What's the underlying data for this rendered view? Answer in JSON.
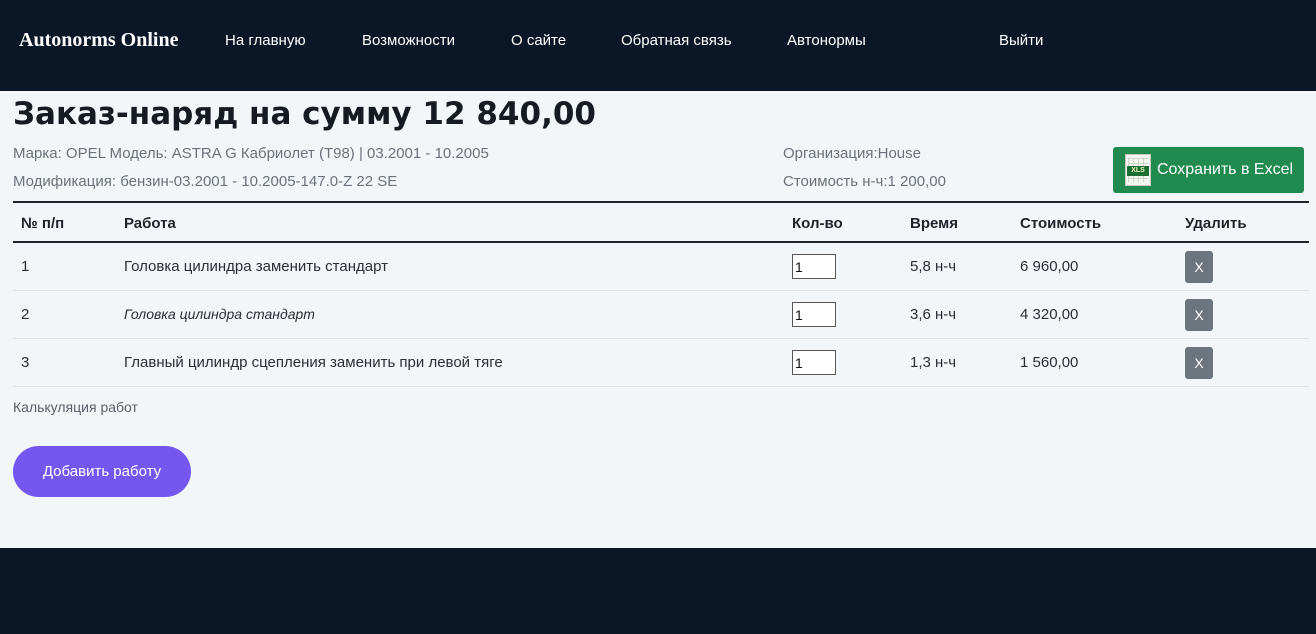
{
  "header": {
    "logo": "Autonorms Online",
    "nav": [
      {
        "label": "На главную"
      },
      {
        "label": "Возможности"
      },
      {
        "label": "О сайте"
      },
      {
        "label": "Обратная связь"
      },
      {
        "label": "Автонормы"
      },
      {
        "label": "Выйти"
      }
    ]
  },
  "order": {
    "title": "Заказ-наряд на сумму 12 840,00",
    "car_line1": "Марка: OPEL Модель: ASTRA G Кабриолет (T98) | 03.2001 - 10.2005",
    "car_line2": "Модификация: бензин-03.2001 - 10.2005-147.0-Z 22 SE",
    "org": "Организация:House",
    "rate": "Стоимость н-ч:1 200,00",
    "excel_button": "Сохранить в Excel",
    "excel_icon_text": "XLS"
  },
  "table": {
    "headers": {
      "num": "№ п/п",
      "work": "Работа",
      "qty": "Кол-во",
      "time": "Время",
      "cost": "Стоимость",
      "delete": "Удалить"
    },
    "rows": [
      {
        "num": "1",
        "work": "Головка цилиндра заменить стандарт",
        "qty": "1",
        "time": "5,8 н-ч",
        "cost": "6 960,00",
        "delete": "X"
      },
      {
        "num": "2",
        "work": "Головка цилиндра стандарт",
        "qty": "1",
        "time": "3,6 н-ч",
        "cost": "4 320,00",
        "delete": "X"
      },
      {
        "num": "3",
        "work": "Главный цилиндр сцепления заменить при левой тяге",
        "qty": "1",
        "time": "1,3 н-ч",
        "cost": "1 560,00",
        "delete": "X"
      }
    ]
  },
  "calc_label": "Калькуляция работ",
  "add_button": "Добавить работу",
  "colors": {
    "navbar": "#0b1626",
    "content_bg": "#f3f6f9",
    "excel_button": "#218a4e",
    "add_button": "#7357f0",
    "delete_button": "#6c757d"
  }
}
